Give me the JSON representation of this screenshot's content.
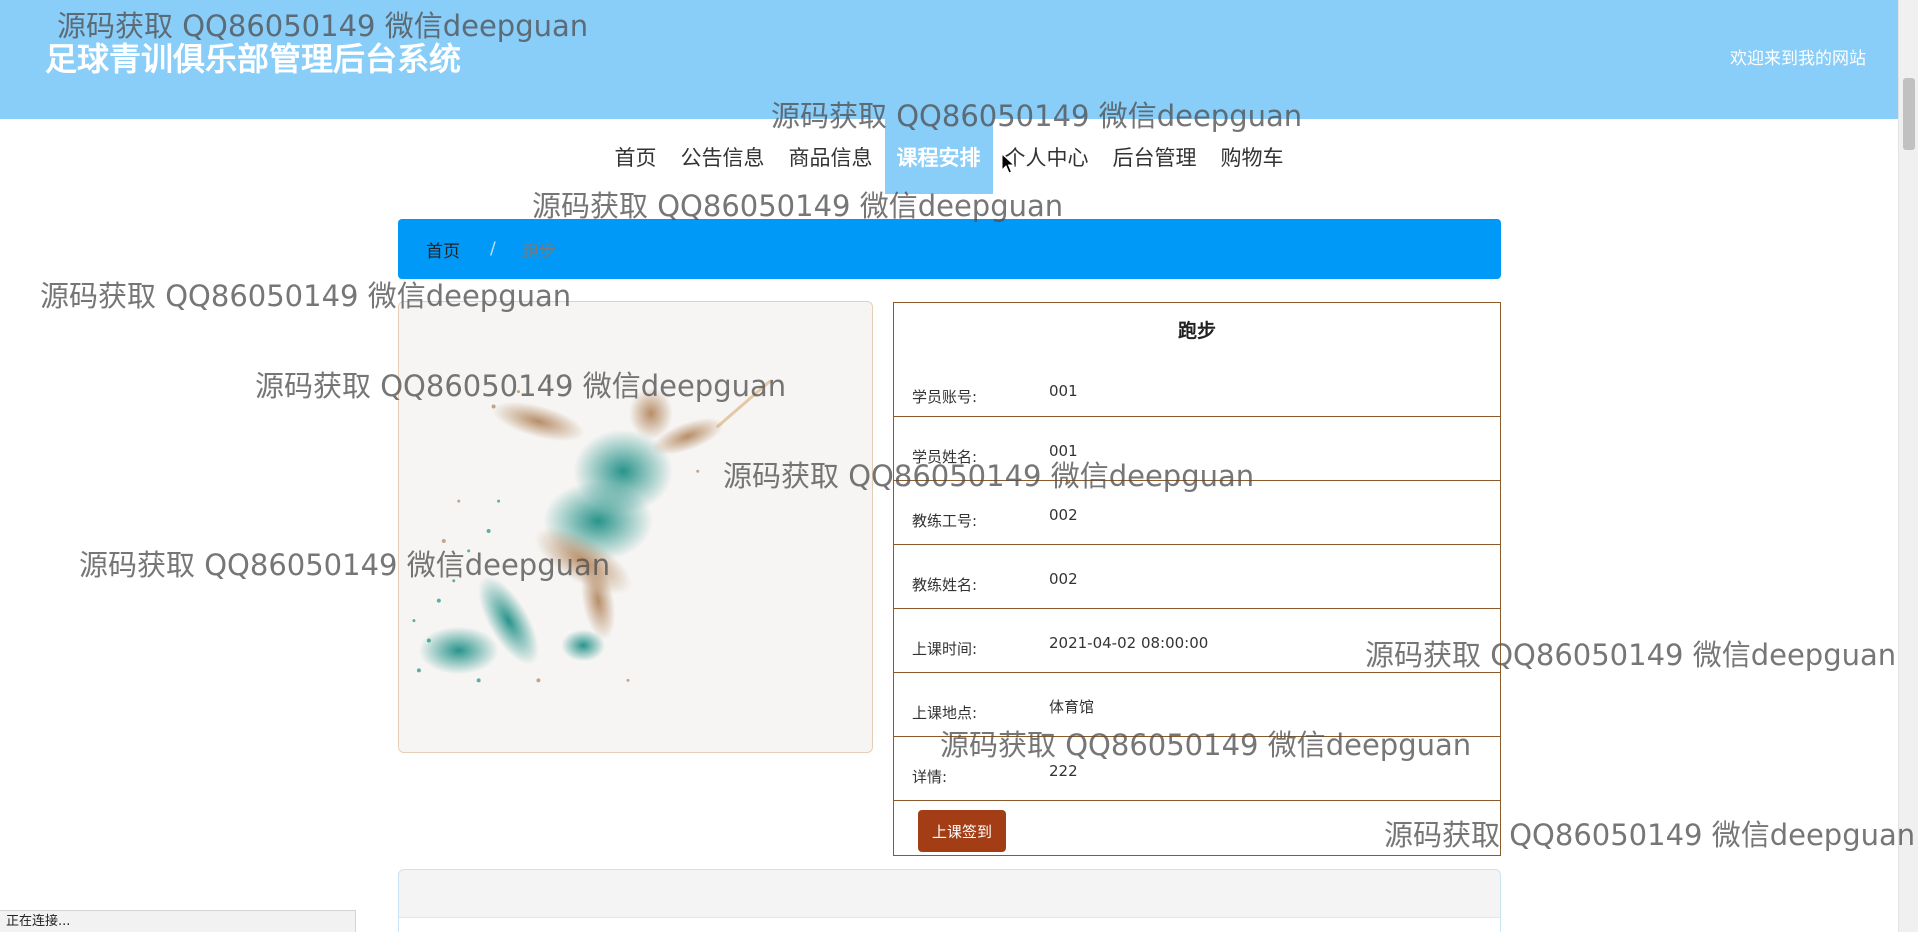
{
  "header": {
    "site_title": "足球青训俱乐部管理后台系统",
    "welcome": "欢迎来到我的网站"
  },
  "nav": {
    "items": [
      {
        "label": "首页"
      },
      {
        "label": "公告信息"
      },
      {
        "label": "商品信息"
      },
      {
        "label": "课程安排",
        "active": true
      },
      {
        "label": "个人中心"
      },
      {
        "label": "后台管理"
      },
      {
        "label": "购物车"
      }
    ]
  },
  "breadcrumb": {
    "home": "首页",
    "separator": "/",
    "current": "跑步"
  },
  "image": {
    "icon": "runner-illustration"
  },
  "detail": {
    "title": "跑步",
    "fields": [
      {
        "label": "学员账号:",
        "value": "001"
      },
      {
        "label": "学员姓名:",
        "value": "001"
      },
      {
        "label": "教练工号:",
        "value": "002"
      },
      {
        "label": "教练姓名:",
        "value": "002"
      },
      {
        "label": "上课时间:",
        "value": "2021-04-02 08:00:00"
      },
      {
        "label": "上课地点:",
        "value": "体育馆"
      },
      {
        "label": "详情:",
        "value": "222"
      }
    ],
    "signin_button": "上课签到"
  },
  "status_bar": {
    "text": "正在连接..."
  },
  "watermark": {
    "text": "源码获取 QQ86050149 微信deepguan"
  },
  "colors": {
    "header_bg": "#89cdf9",
    "breadcrumb_bg": "#0099f7",
    "button_bg": "#a23d16",
    "table_border": "#8b5a2b"
  }
}
